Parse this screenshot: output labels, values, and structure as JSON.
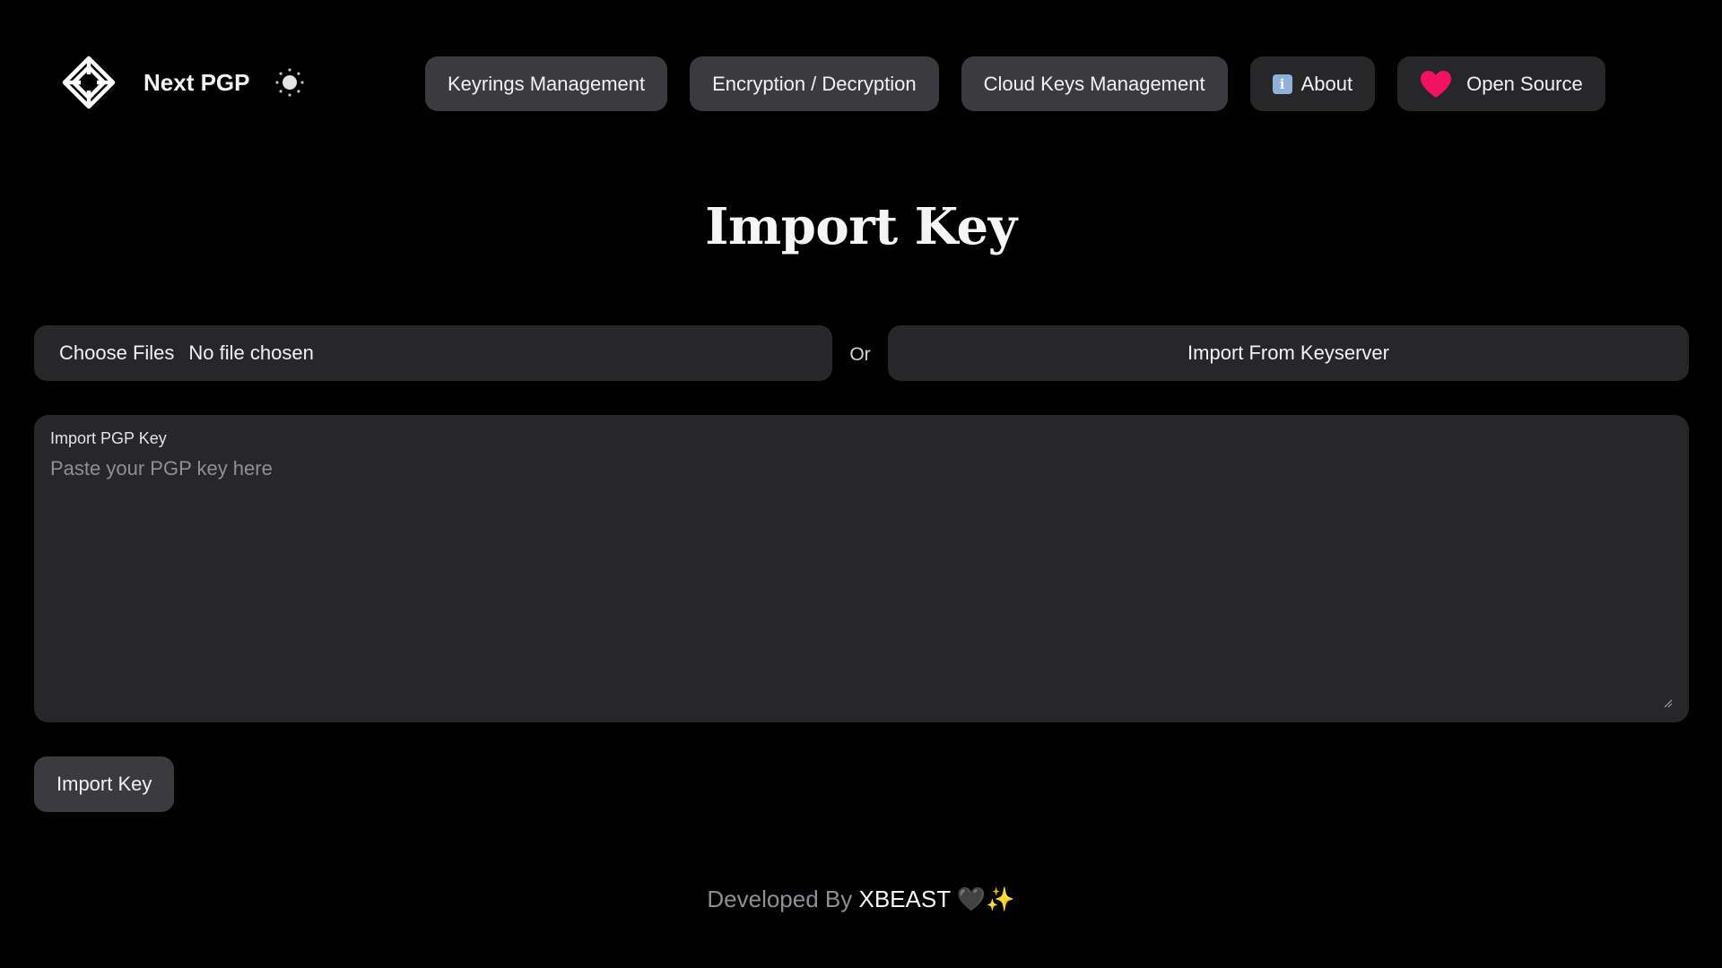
{
  "brand": {
    "name": "Next PGP"
  },
  "nav": {
    "items": [
      {
        "label": "Keyrings Management"
      },
      {
        "label": "Encryption / Decryption"
      },
      {
        "label": "Cloud Keys Management"
      },
      {
        "label": "About",
        "icon": "info-icon"
      },
      {
        "label": "Open Source",
        "icon": "heart-icon"
      }
    ]
  },
  "page": {
    "title": "Import Key"
  },
  "file_input": {
    "button_label": "Choose Files",
    "status": "No file chosen"
  },
  "separator": {
    "text": "Or"
  },
  "keyserver": {
    "button_label": "Import From Keyserver"
  },
  "key_textarea": {
    "label": "Import PGP Key",
    "placeholder": "Paste your PGP key here",
    "value": ""
  },
  "import_button": {
    "label": "Import Key"
  },
  "footer": {
    "prefix": "Developed By",
    "author": "XBEAST",
    "emoji": "🖤✨"
  },
  "colors": {
    "background": "#000000",
    "surface": "#27272a",
    "button": "#3a3a3f",
    "heart": "#f31260",
    "text": "#f2f2f4",
    "muted": "#8e8e94"
  }
}
